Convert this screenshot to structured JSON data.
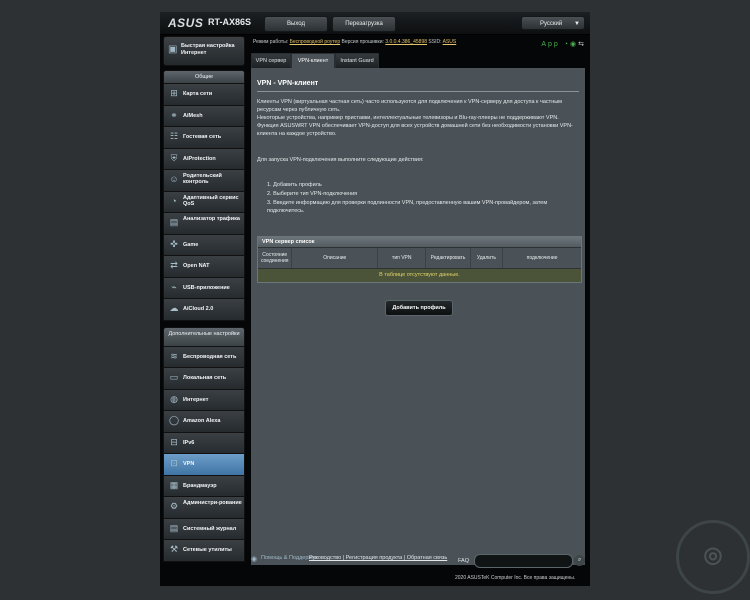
{
  "header": {
    "logo": "ASUS",
    "model": "RT-AX86S",
    "logout_label": "Выход",
    "reboot_label": "Перезагрузка",
    "language": "Русский"
  },
  "status": {
    "mode_label": "Режим работы:",
    "mode_value": "Беспроводной роутер",
    "fw_label": "Версия прошивки:",
    "fw_value": "3.0.0.4.386_45898",
    "ssid_label": "SSID:",
    "ssid_value": "ASUS",
    "app_label": "App"
  },
  "sidebar": {
    "quick_setup": "Быстрая настройка Интернет",
    "general_header": "Общие",
    "general": [
      {
        "label": "Карта сети",
        "icon": "network-map-icon"
      },
      {
        "label": "AiMesh",
        "icon": "aimesh-icon"
      },
      {
        "label": "Гостевая сеть",
        "icon": "guest-network-icon"
      },
      {
        "label": "AiProtection",
        "icon": "shield-icon"
      },
      {
        "label": "Родительский контроль",
        "icon": "parental-icon"
      },
      {
        "label": "Адаптивный сервис QoS",
        "icon": "qos-icon"
      },
      {
        "label": "Анализатор трафика",
        "icon": "traffic-icon"
      },
      {
        "label": "Game",
        "icon": "gamepad-icon"
      },
      {
        "label": "Open NAT",
        "icon": "nat-icon"
      },
      {
        "label": "USB-приложение",
        "icon": "usb-icon"
      },
      {
        "label": "AiCloud 2.0",
        "icon": "cloud-icon"
      }
    ],
    "advanced_header": "Дополнительные настройки",
    "advanced": [
      {
        "label": "Беспроводная сеть",
        "icon": "wireless-icon"
      },
      {
        "label": "Локальная сеть",
        "icon": "lan-icon"
      },
      {
        "label": "Интернет",
        "icon": "globe-icon"
      },
      {
        "label": "Amazon Alexa",
        "icon": "alexa-icon"
      },
      {
        "label": "IPv6",
        "icon": "ipv6-icon"
      },
      {
        "label": "VPN",
        "icon": "vpn-icon"
      },
      {
        "label": "Брандмауэр",
        "icon": "firewall-icon"
      },
      {
        "label": "Администри-рование",
        "icon": "admin-icon"
      },
      {
        "label": "Системный журнал",
        "icon": "log-icon"
      },
      {
        "label": "Сетевые утилиты",
        "icon": "tools-icon"
      }
    ]
  },
  "tabs": [
    "VPN сервер",
    "VPN-клиент",
    "Instant Guard"
  ],
  "content": {
    "title": "VPN - VPN-клиент",
    "p1": "Клиенты VPN (виртуальная частная сеть) часто используются для подключения к VPN-серверу для доступа к частным ресурсам через публичную сеть.",
    "p2": "Некоторые устройства, например приставки, интеллектуальные телевизоры и Blu-ray-плееры не поддерживают VPN.",
    "p3": "Функция ASUSWRT VPN обеспечивает VPN-доступ для всех устройств домашней сети без необходимости установки VPN-клиента на каждое устройство.",
    "intro": "Для запуска VPN-подключения выполните следующие действия:",
    "steps": [
      "1. Добавить профиль",
      "2. Выберите тип VPN-подключения",
      "3. Введите информацию для проверки подлинности VPN, предоставленную вашим VPN-провайдером, затем подключитесь."
    ],
    "table_title": "VPN сервер список",
    "columns": [
      "Состояние соединения",
      "Описание",
      "тип VPN",
      "Редактировать",
      "Удалить",
      "подключение"
    ],
    "empty": "В таблице отсутствуют данные.",
    "add_profile": "Добавить профиль"
  },
  "footer": {
    "help": "Помощь & Поддержка",
    "links": "Руководство | Регистрация продукта | Обратная связь",
    "faq": "FAQ",
    "copyright": "2020 ASUSTeK Computer Inc. Все права защищены."
  },
  "colors": {
    "active_nav": "#4f86b8",
    "panel": "#4a5257",
    "empty_text": "#e3d46a"
  }
}
